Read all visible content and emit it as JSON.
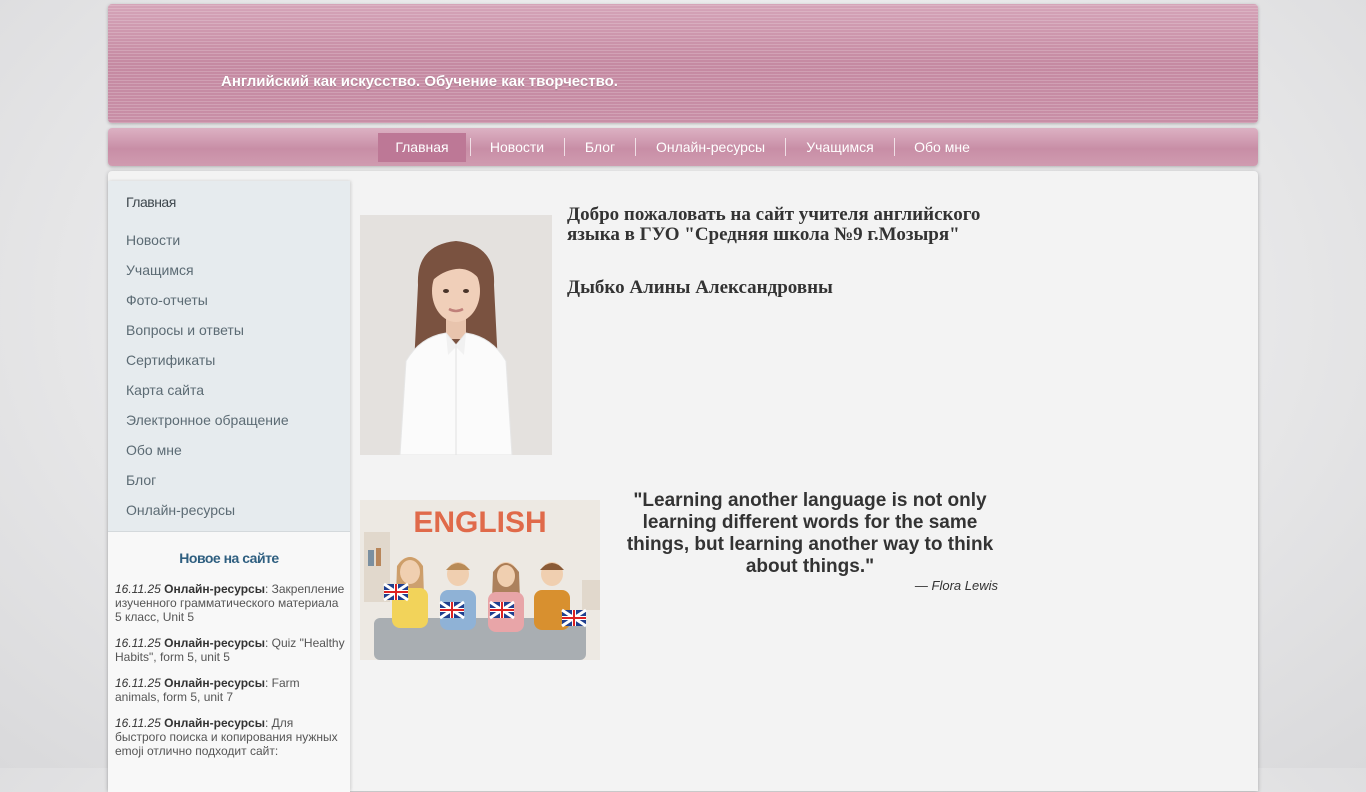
{
  "header": {
    "tagline": "Английский как искусство. Обучение как творчество."
  },
  "nav": {
    "items": [
      {
        "label": "Главная",
        "active": true
      },
      {
        "label": "Новости"
      },
      {
        "label": "Блог"
      },
      {
        "label": "Онлайн-ресурсы"
      },
      {
        "label": "Учащимся"
      },
      {
        "label": "Обо мне"
      }
    ]
  },
  "sidebar": {
    "items": [
      {
        "label": "Главная",
        "active": true
      },
      {
        "label": "Новости"
      },
      {
        "label": "Учащимся"
      },
      {
        "label": "Фото-отчеты"
      },
      {
        "label": "Вопросы и ответы"
      },
      {
        "label": "Сертификаты"
      },
      {
        "label": "Карта сайта"
      },
      {
        "label": "Электронное обращение"
      },
      {
        "label": "Обо мне"
      },
      {
        "label": "Блог"
      },
      {
        "label": "Онлайн-ресурсы"
      }
    ],
    "news": {
      "title": "Новое на сайте",
      "entries": [
        {
          "date": "16.11.25",
          "category": "Онлайн-ресурсы",
          "text": ": Закрепление изученного грамматического материала 5 класс, Unit 5"
        },
        {
          "date": "16.11.25",
          "category": "Онлайн-ресурсы",
          "text": ": Quiz \"Healthy Habits\", form 5, unit 5"
        },
        {
          "date": "16.11.25",
          "category": "Онлайн-ресурсы",
          "text": ": Farm animals, form 5, unit 7"
        },
        {
          "date": "16.11.25",
          "category": "Онлайн-ресурсы",
          "text": ": Для быстрого поиска и копирования нужных emoji отлично подходит сайт:"
        }
      ]
    }
  },
  "main": {
    "welcome": "Добро пожаловать на сайт учителя английского языка в ГУО \"Средняя школа №9 г.Мозыря\"",
    "name": "Дыбко Алины Александровны",
    "english_banner": "ENGLISH",
    "quote": "\"Learning another language is not only learning different words for the same things, but learning another way to think about things.\"",
    "quote_author": "— Flora Lewis"
  },
  "colors": {
    "header": "#c88ea6",
    "nav_active": "#bd7896",
    "news_title": "#2f5f80"
  }
}
